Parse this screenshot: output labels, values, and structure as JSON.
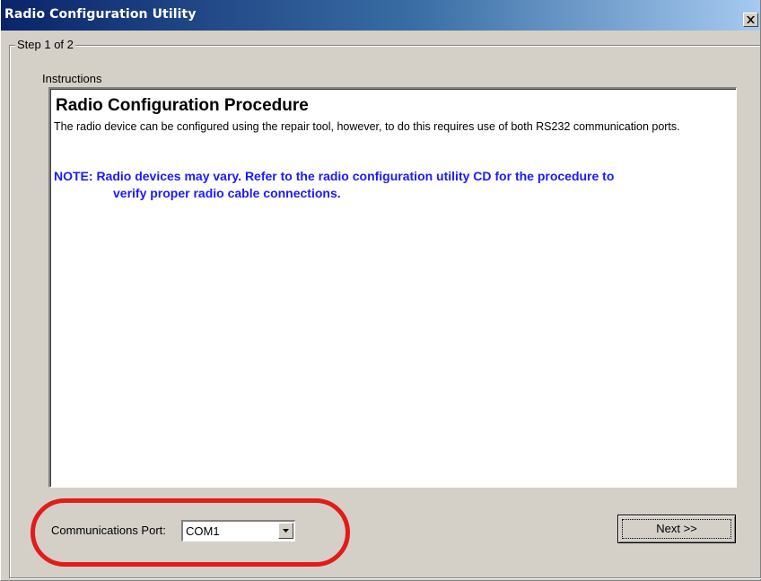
{
  "window": {
    "title": "Radio Configuration Utility",
    "close_glyph": "close-icon"
  },
  "step": {
    "label": "Step 1 of 2"
  },
  "instructions": {
    "label": "Instructions",
    "title": "Radio Configuration Procedure",
    "body": "The radio device can be configured using the repair tool, however, to do this requires use of both RS232 communication ports.",
    "note_line1": "NOTE:  Radio devices may vary. Refer to the radio configuration utility CD for the procedure to",
    "note_line2": "verify proper radio cable connections.",
    "note_color": "#1a1aff"
  },
  "port": {
    "label": "Communications Port:",
    "selected_value": "COM1",
    "dropdown_icon": "chevron-down-icon"
  },
  "buttons": {
    "next_label": "Next >>"
  },
  "annotation": {
    "highlight_color": "#e21b1b"
  },
  "colors": {
    "titlebar_start": "#0a246a",
    "titlebar_end": "#a6caf0",
    "dialog_bg": "#d4d0c8"
  }
}
